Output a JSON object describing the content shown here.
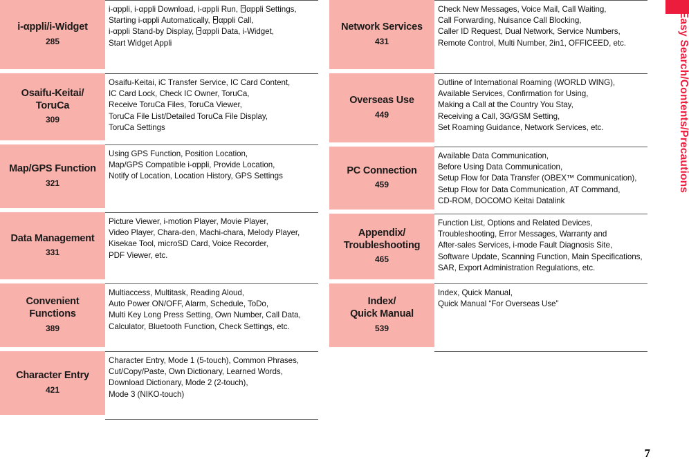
{
  "side_tab": {
    "label": "Easy Search/Contents/Precautions",
    "accent_color": "#ec1c3c"
  },
  "page_number": "7",
  "theme": {
    "category_bg": "#f8b1ab",
    "rule_color": "#555555",
    "text_color": "#111111"
  },
  "left_column": [
    {
      "title": "i-αppli/i-Widget",
      "page": "285",
      "lines": [
        "i-αppli, i-αppli Download, i-αppli Run, ▯αppli Settings,",
        "Starting i-αppli Automatically, ▯αppli Call,",
        "i-αppli Stand-by Display, ▯αppli Data, i-Widget,",
        "Start Widget Appli"
      ]
    },
    {
      "title": "Osaifu-Keitai/\nToruCa",
      "page": "309",
      "lines": [
        "Osaifu-Keitai, iC Transfer Service, IC Card Content,",
        "IC Card Lock, Check IC Owner, ToruCa,",
        "Receive ToruCa Files, ToruCa Viewer,",
        "ToruCa File List/Detailed ToruCa File Display,",
        "ToruCa Settings"
      ]
    },
    {
      "title": "Map/GPS Function",
      "page": "321",
      "lines": [
        "Using GPS Function, Position Location,",
        "Map/GPS Compatible i-αppli, Provide Location,",
        "Notify of Location, Location History, GPS Settings"
      ]
    },
    {
      "title": "Data Management",
      "page": "331",
      "lines": [
        "Picture Viewer, i-motion Player, Movie Player,",
        "Video Player, Chara-den, Machi-chara, Melody Player,",
        "Kisekae Tool, microSD Card, Voice Recorder,",
        "PDF Viewer, etc."
      ]
    },
    {
      "title": "Convenient\nFunctions",
      "page": "389",
      "lines": [
        "Multiaccess, Multitask, Reading Aloud,",
        "Auto Power ON/OFF, Alarm, Schedule, ToDo,",
        "Multi Key Long Press Setting, Own Number, Call Data,",
        "Calculator, Bluetooth Function, Check Settings, etc."
      ]
    },
    {
      "title": "Character Entry",
      "page": "421",
      "lines": [
        "Character Entry, Mode 1 (5-touch), Common Phrases,",
        "Cut/Copy/Paste, Own Dictionary, Learned Words,",
        "Download Dictionary, Mode 2 (2-touch),",
        "Mode 3 (NIKO-touch)"
      ]
    }
  ],
  "right_column": [
    {
      "title": "Network Services",
      "page": "431",
      "lines": [
        "Check New Messages, Voice Mail, Call Waiting,",
        "Call Forwarding, Nuisance Call Blocking,",
        "Caller ID Request, Dual Network, Service Numbers,",
        "Remote Control, Multi Number, 2in1, OFFICEED, etc."
      ]
    },
    {
      "title": "Overseas Use",
      "page": "449",
      "lines": [
        "Outline of International Roaming (WORLD WING),",
        "Available Services, Confirmation for Using,",
        "Making a Call at the Country You Stay,",
        "Receiving a Call, 3G/GSM Setting,",
        "Set Roaming Guidance, Network Services, etc."
      ]
    },
    {
      "title": "PC Connection",
      "page": "459",
      "lines": [
        "Available Data Communication,",
        "Before Using Data Communication,",
        "Setup Flow for Data Transfer (OBEX™ Communication),",
        "Setup Flow for Data Communication, AT Command,",
        "CD-ROM, DOCOMO Keitai Datalink"
      ]
    },
    {
      "title": "Appendix/\nTroubleshooting",
      "page": "465",
      "lines": [
        "Function List, Options and Related Devices,",
        "Troubleshooting, Error Messages, Warranty and",
        "After-sales Services, i-mode Fault Diagnosis Site,",
        "Software Update, Scanning Function, Main Specifications,",
        "SAR, Export Administration Regulations, etc."
      ]
    },
    {
      "title": "Index/\nQuick Manual",
      "page": "539",
      "lines": [
        "Index, Quick Manual,",
        "Quick Manual “For Overseas Use”"
      ]
    }
  ]
}
